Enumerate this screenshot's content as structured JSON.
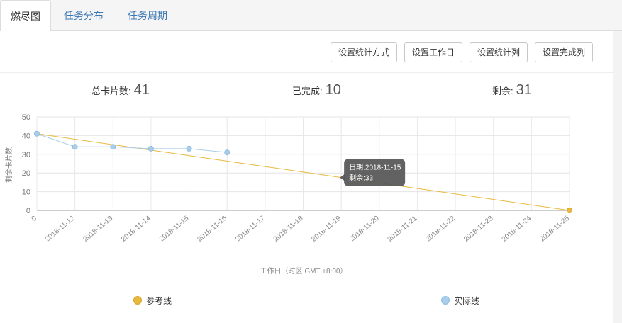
{
  "tabs": [
    {
      "label": "燃尽图",
      "active": true
    },
    {
      "label": "任务分布",
      "active": false
    },
    {
      "label": "任务周期",
      "active": false
    }
  ],
  "toolbar": {
    "stat_method": "设置统计方式",
    "workdays": "设置工作日",
    "stat_column": "设置统计列",
    "done_column": "设置完成列"
  },
  "stats": {
    "total_label": "总卡片数:",
    "total_value": "41",
    "done_label": "已完成:",
    "done_value": "10",
    "remaining_label": "剩余:",
    "remaining_value": "31"
  },
  "colors": {
    "reference": "#e8b93c",
    "actual": "#a9cdea",
    "tooltip_bg": "#555555"
  },
  "tooltip": {
    "date_line": "日期:2018-11-15",
    "remaining_line": "剩余:33"
  },
  "chart_data": {
    "type": "line",
    "categories": [
      "0",
      "2018-11-12",
      "2018-11-13",
      "2018-11-14",
      "2018-11-15",
      "2018-11-16",
      "2018-11-17",
      "2018-11-18",
      "2018-11-19",
      "2018-11-20",
      "2018-11-21",
      "2018-11-22",
      "2018-11-23",
      "2018-11-24",
      "2018-11-25"
    ],
    "series": [
      {
        "name": "参考线",
        "values": [
          41,
          null,
          null,
          null,
          null,
          null,
          null,
          null,
          null,
          null,
          null,
          null,
          null,
          null,
          0
        ]
      },
      {
        "name": "实际线",
        "values": [
          41,
          34,
          34,
          33,
          33,
          31,
          null,
          null,
          null,
          null,
          null,
          null,
          null,
          null,
          null
        ]
      }
    ],
    "ylim": [
      0,
      50
    ],
    "yticks": [
      0,
      10,
      20,
      30,
      40,
      50
    ],
    "xlabel": "工作日（时区 GMT +8:00）",
    "ylabel": "剩余卡片数",
    "grid": true,
    "legend": "bottom",
    "tooltip_at_category": "2018-11-19"
  }
}
